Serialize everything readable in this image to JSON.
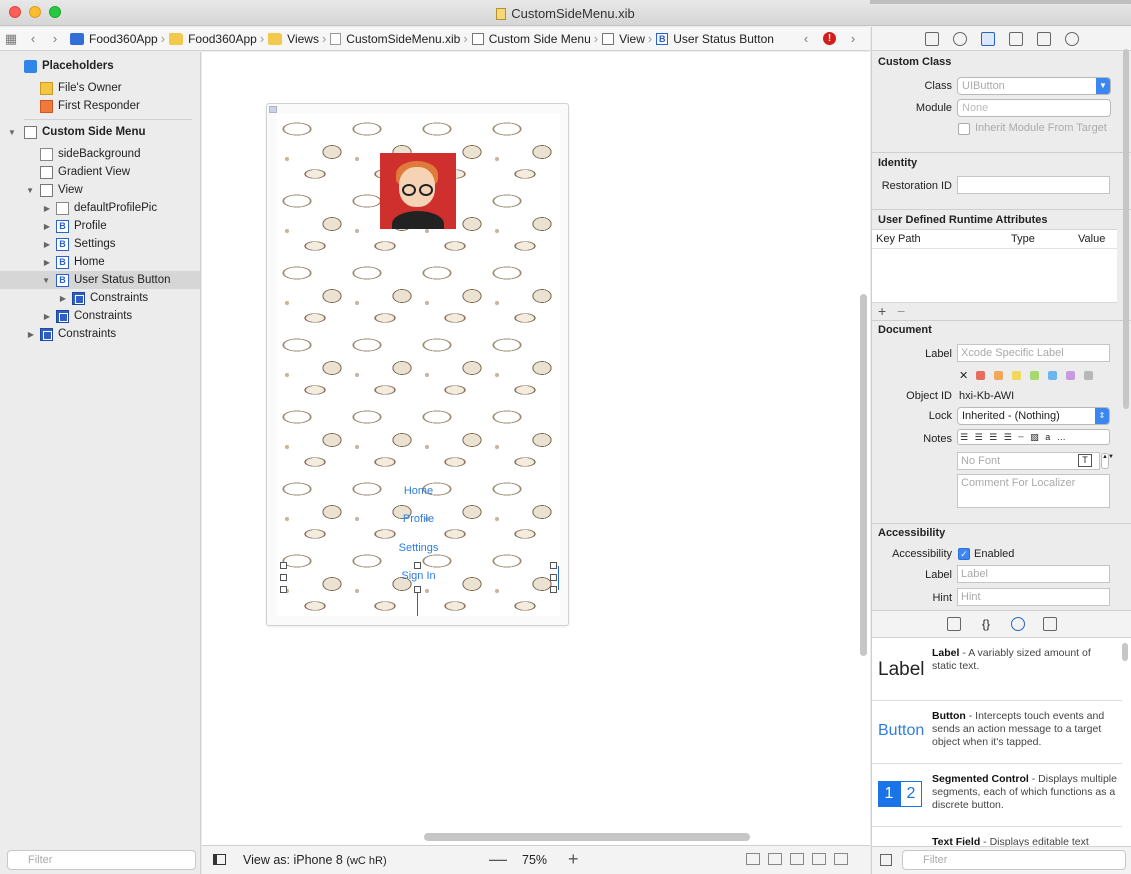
{
  "window": {
    "title": "CustomSideMenu.xib"
  },
  "jumpbar": {
    "crumbs": [
      "Food360App",
      "Food360App",
      "Views",
      "CustomSideMenu.xib",
      "Custom Side Menu",
      "View",
      "User Status Button"
    ]
  },
  "navigator": {
    "placeholders": "Placeholders",
    "files_owner": "File's Owner",
    "first_responder": "First Responder",
    "custom_side_menu": "Custom Side Menu",
    "side_background": "sideBackground",
    "gradient_view": "Gradient View",
    "view": "View",
    "default_profile_pic": "defaultProfilePic",
    "profile": "Profile",
    "settings": "Settings",
    "home": "Home",
    "user_status_button": "User Status Button",
    "constraints_inner": "Constraints",
    "constraints_view": "Constraints",
    "constraints_root": "Constraints",
    "filter_placeholder": "Filter"
  },
  "canvas": {
    "menu": [
      "Home",
      "Profile",
      "Settings",
      "Sign In"
    ]
  },
  "bottombar": {
    "view_as_label": "View as: iPhone 8",
    "size_class": "(wC hR)",
    "zoom": "75%"
  },
  "inspector": {
    "custom_class": {
      "title": "Custom Class",
      "class_label": "Class",
      "class_placeholder": "UIButton",
      "module_label": "Module",
      "module_placeholder": "None",
      "inherit_label": "Inherit Module From Target"
    },
    "identity": {
      "title": "Identity",
      "restoration_label": "Restoration ID"
    },
    "runtime_attrs": {
      "title": "User Defined Runtime Attributes",
      "col_key": "Key Path",
      "col_type": "Type",
      "col_value": "Value",
      "add": "+",
      "remove": "−"
    },
    "document": {
      "title": "Document",
      "label_label": "Label",
      "label_placeholder": "Xcode Specific Label",
      "object_id_label": "Object ID",
      "object_id": "hxi-Kb-AWI",
      "lock_label": "Lock",
      "lock_value": "Inherited - (Nothing)",
      "notes_label": "Notes",
      "font_placeholder": "No Font",
      "comment_placeholder": "Comment For Localizer",
      "swatches": [
        "#e86b5f",
        "#f3a75a",
        "#f1d75a",
        "#a8d872",
        "#6cb6ee",
        "#c79be0",
        "#b7b7b7"
      ]
    },
    "accessibility": {
      "title": "Accessibility",
      "acc_label": "Accessibility",
      "enabled_label": "Enabled",
      "label_label": "Label",
      "label_placeholder": "Label",
      "hint_label": "Hint",
      "hint_placeholder": "Hint"
    }
  },
  "library": {
    "items": [
      {
        "thumb": "Label",
        "name": "Label",
        "desc": " - A variably sized amount of static text."
      },
      {
        "thumb": "Button",
        "name": "Button",
        "desc": " - Intercepts touch events and sends an action message to a target object when it's tapped."
      },
      {
        "thumb_a": "1",
        "thumb_b": "2",
        "name": "Segmented Control",
        "desc": " - Displays multiple segments, each of which functions as a discrete button."
      },
      {
        "name": "Text Field",
        "desc": " - Displays editable text"
      }
    ],
    "filter_placeholder": "Filter"
  },
  "colors": {
    "accent": "#2f6fd6",
    "link": "#2f7de1",
    "avatar_bg": "#cf2f2d"
  }
}
